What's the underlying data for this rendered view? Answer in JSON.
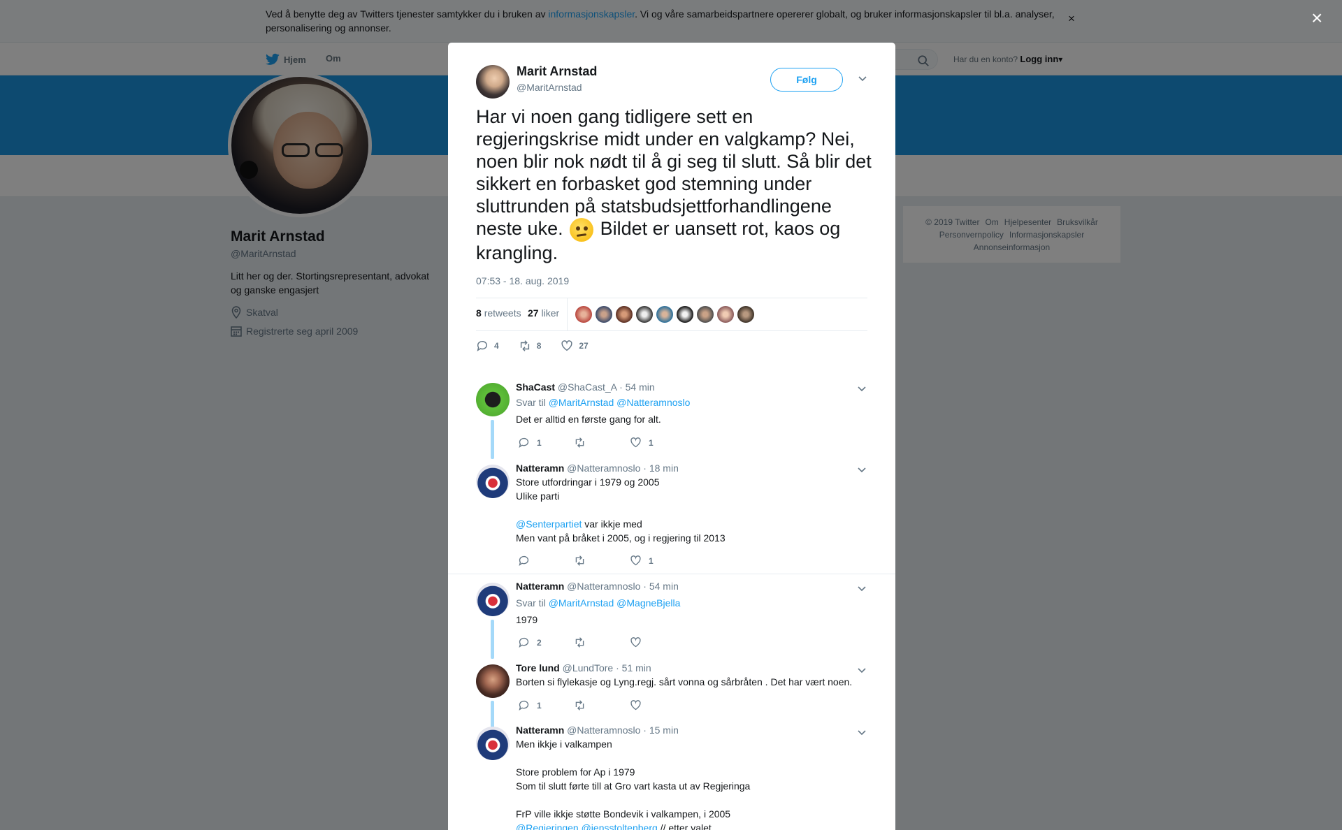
{
  "cookie": {
    "text_before": "Ved å benytte deg av Twitters tjenester samtykker du i bruken av ",
    "link": "informasjonskapsler",
    "text_after": ". Vi og våre samarbeidspartnere opererer globalt, og bruker informasjonskapsler til bl.a. analyser, personalisering og annonser.",
    "close": "×"
  },
  "nav": {
    "home": "Hjem",
    "about": "Om",
    "login_question": "Har du en konto?",
    "login": "Logg inn"
  },
  "profile": {
    "name": "Marit Arnstad",
    "handle": "@MaritArnstad",
    "bio": "Litt her og der. Stortingsrepresentant, advokat og ganske engasjert",
    "location": "Skatval",
    "joined": "Registrerte seg april 2009"
  },
  "footer": {
    "line1": [
      "© 2019 Twitter",
      "Om",
      "Hjelpesenter",
      "Bruksvilkår"
    ],
    "line2": [
      "Personvernpolicy",
      "Informasjonskapsler"
    ],
    "line3": [
      "Annonseinformasjon"
    ]
  },
  "modal": {
    "close": "×",
    "author_name": "Marit Arnstad",
    "author_handle": "@MaritArnstad",
    "follow": "Følg",
    "tweet_part1": "Har vi noen gang tidligere sett en regjeringskrise midt under en valgkamp? Nei, noen blir nok nødt til å gi seg til slutt. Så blir det sikkert en forbasket god stemning under sluttrunden på statsbudsjettforhandlingene neste uke. ",
    "emoji": "face-with-rolling-eyes",
    "tweet_part2": " Bildet er uansett rot, kaos og krangling.",
    "time": "07:53 - 18. aug. 2019",
    "retweets_count": "8",
    "retweets_label": "retweets",
    "likes_count": "27",
    "likes_label": "liker",
    "actions": {
      "replies": "4",
      "retweets": "8",
      "likes": "27"
    }
  },
  "replies": [
    {
      "name": "ShaCast",
      "handle": "@ShaCast_A",
      "time": "· 54 min",
      "reply_to_label": "Svar til",
      "reply_to": [
        "@MaritArnstad",
        "@Natteramnoslo"
      ],
      "lines": [
        "Det er alltid en første gang for alt."
      ],
      "counts": {
        "reply": "1",
        "retweet": "",
        "like": "1"
      }
    },
    {
      "name": "Natteramn",
      "handle": "@Natteramnoslo",
      "time": "· 18 min",
      "lines": [
        "Store utfordringar i 1979 og 2005",
        "Ulike parti",
        "",
        "@Senterpartiet var ikkje med",
        "Men vant på bråket i 2005, og i regjering til 2013"
      ],
      "mention": "@Senterpartiet",
      "mention_rest": " var ikkje med",
      "counts": {
        "reply": "",
        "retweet": "",
        "like": "1"
      }
    },
    {
      "name": "Natteramn",
      "handle": "@Natteramnoslo",
      "time": "· 54 min",
      "reply_to_label": "Svar til",
      "reply_to": [
        "@MaritArnstad",
        "@MagneBjella"
      ],
      "lines": [
        "1979"
      ],
      "counts": {
        "reply": "2",
        "retweet": "",
        "like": ""
      }
    },
    {
      "name": "Tore lund",
      "handle": "@LundTore",
      "time": "· 51 min",
      "lines": [
        "Borten si flylekasje og Lyng.regj.  sårt vonna og sårbråten . Det har vært noen."
      ],
      "counts": {
        "reply": "1",
        "retweet": "",
        "like": ""
      }
    },
    {
      "name": "Natteramn",
      "handle": "@Natteramnoslo",
      "time": "· 15 min",
      "lines": [
        "Men ikkje i valkampen",
        "Store problem for Ap i 1979",
        "Som til slutt førte till at Gro vart kasta ut av Regjeringa",
        "FrP ville ikkje støtte Bondevik i valkampen, i 2005"
      ],
      "last_mentions": "@Regjeringen @jensstoltenberg",
      "last_rest": " // etter valet"
    }
  ],
  "colors": {
    "accent": "#1da1f2",
    "banner": "#1b95e0",
    "overlay": "rgba(0,0,0,0.5)"
  }
}
